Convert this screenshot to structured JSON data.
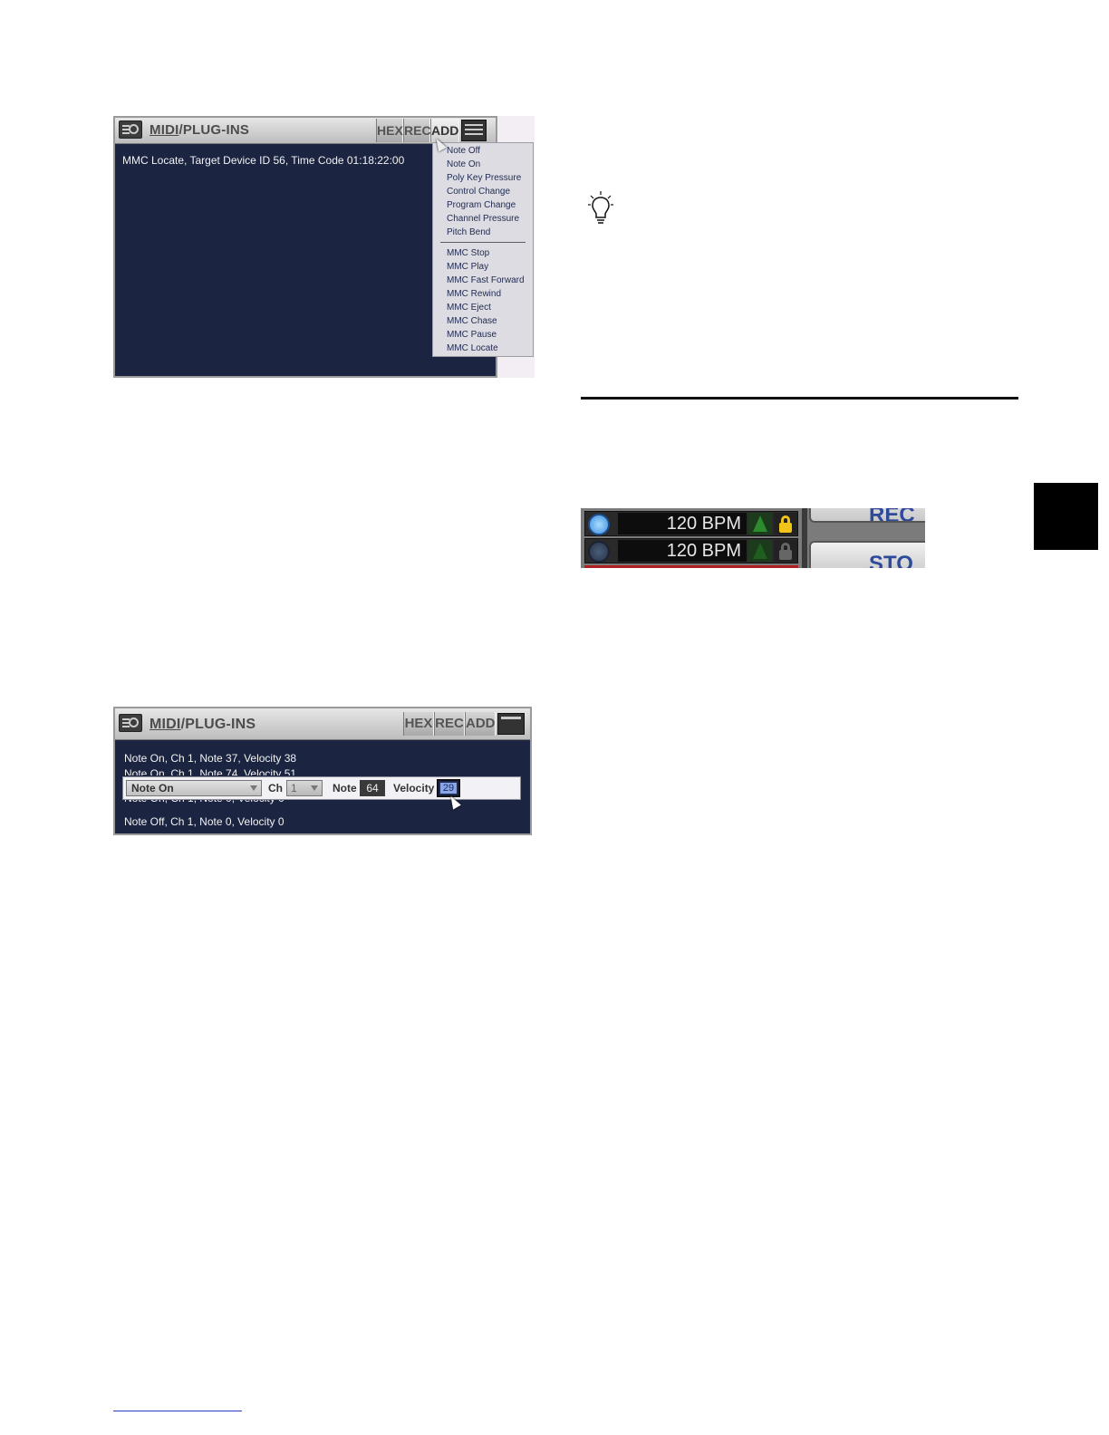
{
  "panel_top": {
    "title_underlined": "MIDI",
    "title_rest": "/PLUG-INS",
    "buttons": [
      "HEX",
      "REC",
      "ADD"
    ],
    "log": [
      "MMC Locate, Target Device ID 56, Time Code 01:18:22:00"
    ],
    "menu_group1": [
      "Note Off",
      "Note On",
      "Poly Key Pressure",
      "Control Change",
      "Program Change",
      "Channel Pressure",
      "Pitch Bend"
    ],
    "menu_group2": [
      "MMC Stop",
      "MMC Play",
      "MMC Fast Forward",
      "MMC Rewind",
      "MMC Eject",
      "MMC Chase",
      "MMC Pause",
      "MMC Locate"
    ]
  },
  "panel_bottom": {
    "title_underlined": "MIDI",
    "title_rest": "/PLUG-INS",
    "buttons": [
      "HEX",
      "REC",
      "ADD"
    ],
    "log": [
      "Note On, Ch 1, Note 37, Velocity 38",
      "Note On, Ch 1, Note 74, Velocity 51",
      "Note On, Ch 1, Note 0, Velocity 0",
      "Note Off, Ch 1, Note 0, Velocity 0"
    ],
    "editor": {
      "type": "Note On",
      "ch_label": "Ch",
      "ch_value": "1",
      "note_label": "Note",
      "note_value": "64",
      "velocity_label": "Velocity",
      "velocity_value": "29"
    }
  },
  "tempo": {
    "rows": [
      {
        "bpm": "120 BPM"
      },
      {
        "bpm": "120 BPM"
      }
    ],
    "buttons": [
      "REC",
      "STO"
    ]
  },
  "icons": {
    "tip": "lightbulb-icon",
    "midi": "midi-port-icon",
    "lock": "lock-icon",
    "tempo_up": "triangle-icon"
  },
  "colors": {
    "panel_bg": "#1b2440",
    "menu_text": "#1f2a50",
    "bpm_led": "#4aa3f0",
    "lock_yellow": "#f0c419"
  }
}
